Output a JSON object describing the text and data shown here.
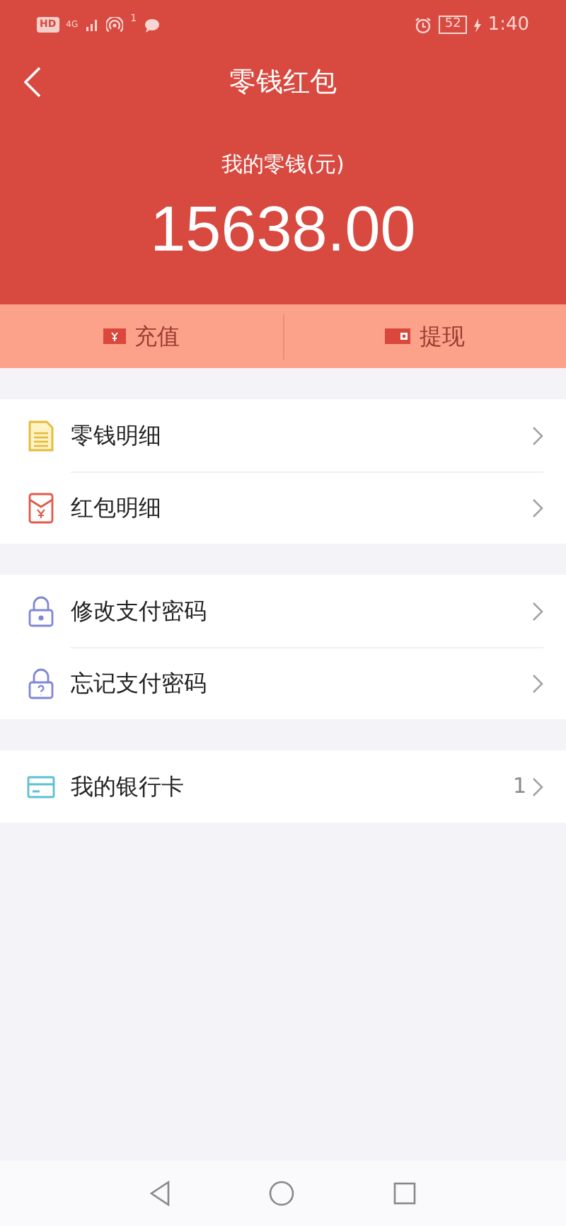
{
  "status_bar": {
    "hd": "HD",
    "network": "4G",
    "hotspot_count": "1",
    "battery": "52",
    "time": "1:40"
  },
  "header": {
    "title": "零钱红包",
    "balance_label": "我的零钱(元)",
    "balance": "15638.00"
  },
  "actions": [
    {
      "kind": "recharge",
      "label": "充值"
    },
    {
      "kind": "withdraw",
      "label": "提现"
    }
  ],
  "groups": [
    [
      {
        "kind": "doc",
        "label": "零钱明细"
      },
      {
        "kind": "envelope",
        "label": "红包明细"
      }
    ],
    [
      {
        "kind": "lock",
        "label": "修改支付密码"
      },
      {
        "kind": "lock-question",
        "label": "忘记支付密码"
      }
    ],
    [
      {
        "kind": "card",
        "label": "我的银行卡",
        "count": "1"
      }
    ]
  ]
}
